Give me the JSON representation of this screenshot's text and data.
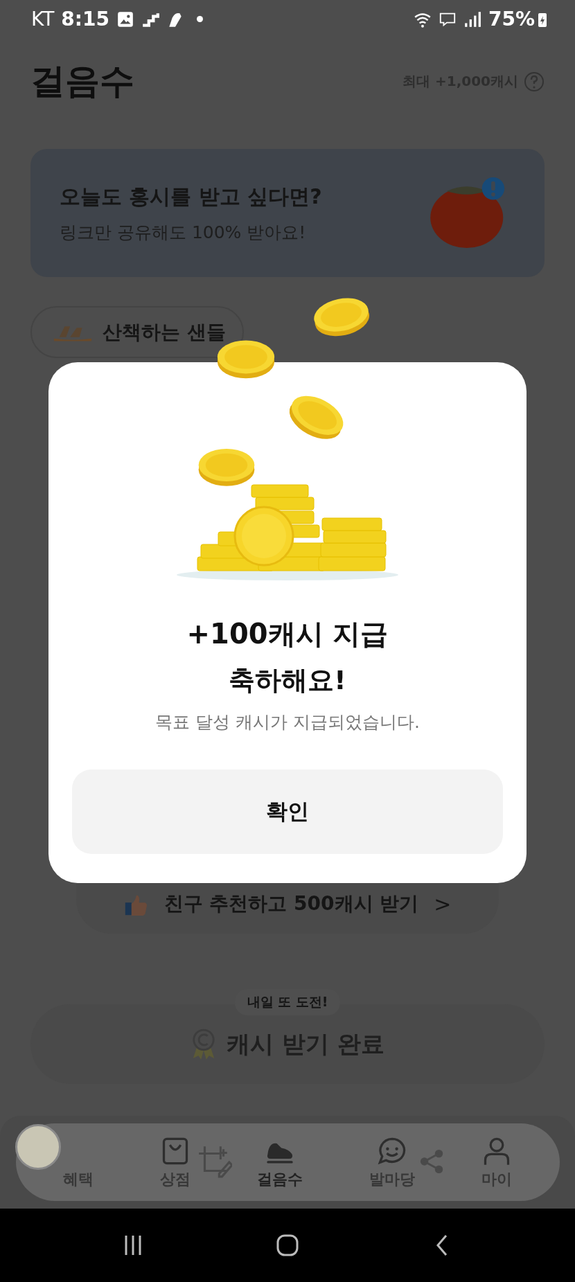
{
  "status_bar": {
    "carrier": "KT",
    "time": "8:15",
    "battery": "75%"
  },
  "header": {
    "title": "걸음수",
    "max_reward": "최대 +1,000캐시"
  },
  "banner": {
    "title": "오늘도 홍시를 받고 싶다면?",
    "subtitle": "링크만 공유해도 100% 받아요!"
  },
  "chip": {
    "label": "산책하는 샌들"
  },
  "referral": {
    "label": "친구 추천하고 500캐시 받기",
    "chevron": ">"
  },
  "cash_button": {
    "tooltip": "내일 또 도전!",
    "label": "캐시 받기 완료",
    "disabled": true
  },
  "bottom_nav": [
    {
      "label": "혜택",
      "selected": false
    },
    {
      "label": "상점",
      "selected": false
    },
    {
      "label": "걸음수",
      "selected": true
    },
    {
      "label": "발마당",
      "selected": false
    },
    {
      "label": "마이",
      "selected": false
    }
  ],
  "dialog": {
    "title": "+100캐시 지급",
    "heading": "축하해요!",
    "message": "목표 달성 캐시가 지급되었습니다.",
    "confirm": "확인"
  }
}
